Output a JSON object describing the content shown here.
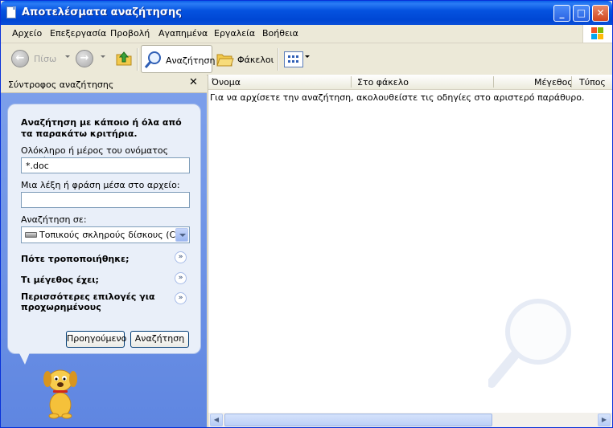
{
  "window": {
    "title": "Αποτελέσματα αναζήτησης"
  },
  "menu": [
    "Αρχείο",
    "Επεξεργασία",
    "Προβολή",
    "Αγαπημένα",
    "Εργαλεία",
    "Βοήθεια"
  ],
  "toolbar": {
    "back": "Πίσω",
    "search": "Αναζήτηση",
    "folders": "Φάκελοι"
  },
  "left_pane": {
    "title": "Σύντροφος αναζήτησης",
    "heading": "Αναζήτηση με κάποιο ή όλα από τα παρακάτω κριτήρια.",
    "filename_label": "Ολόκληρο ή μέρος του ονόματος αρχείου:",
    "filename_value": "*.doc",
    "phrase_label": "Μια λέξη ή φράση μέσα στο αρχείο:",
    "phrase_value": "",
    "lookin_label": "Αναζήτηση σε:",
    "lookin_value": "Τοπικούς σκληρούς δίσκους (C:)",
    "expanders": [
      "Πότε τροποποιήθηκε;",
      "Τι μέγεθος έχει;",
      "Περισσότερες επιλογές για προχωρημένους"
    ],
    "back_button": "Προηγούμενο",
    "search_button": "Αναζήτηση"
  },
  "results": {
    "columns": [
      "Όνομα",
      "Στο φάκελο",
      "Μέγεθος",
      "Τύπος"
    ],
    "message": "Για να αρχίσετε την αναζήτηση, ακολουθείστε τις οδηγίες στο αριστερό παράθυρο."
  }
}
